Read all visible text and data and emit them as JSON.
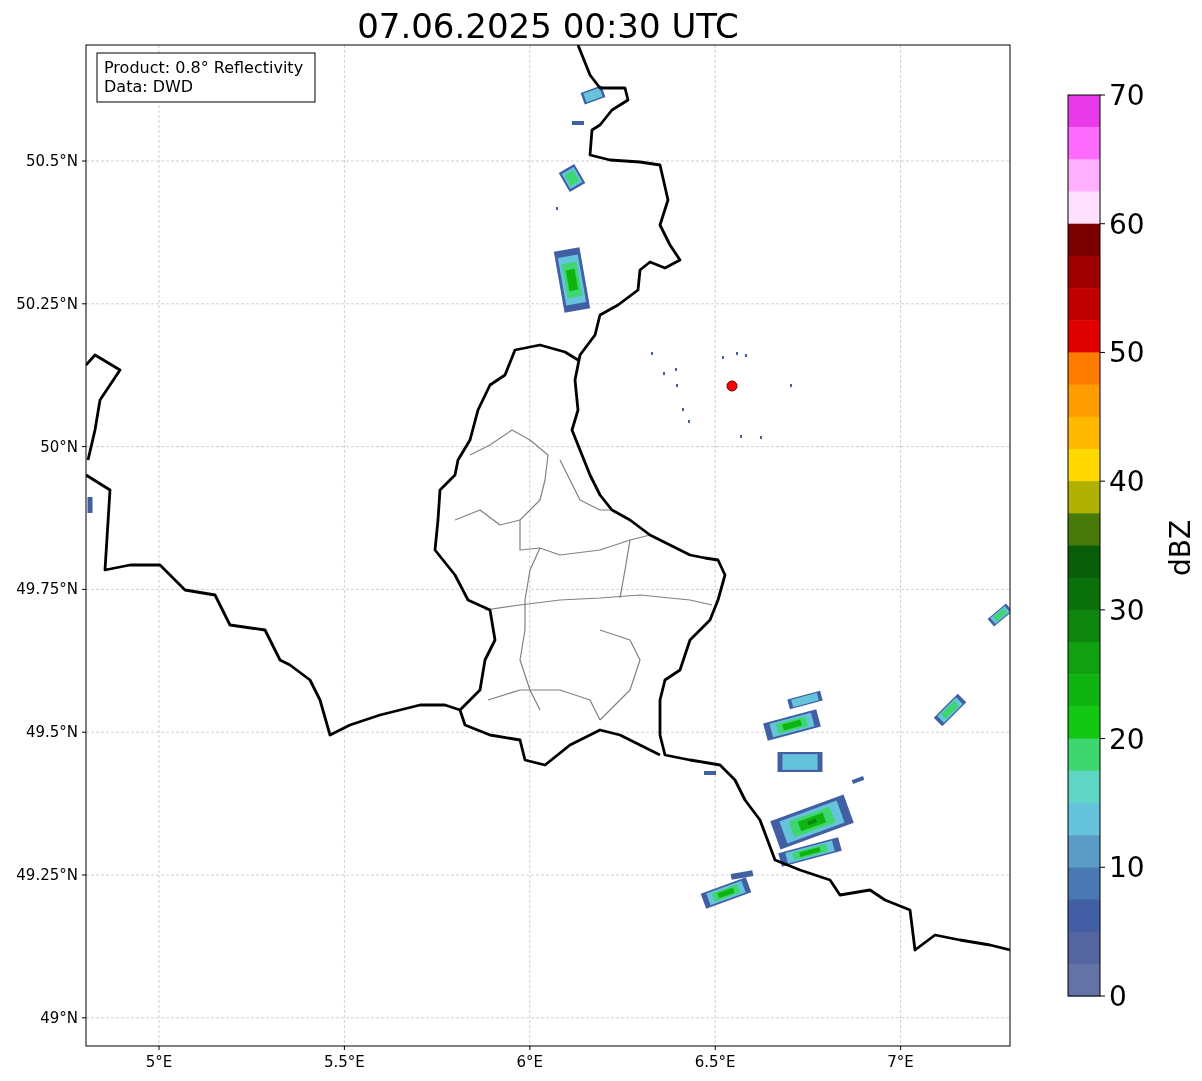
{
  "title": "07.06.2025 00:30 UTC",
  "info_box": [
    "Product: 0.8° Reflectivity",
    "Data: DWD"
  ],
  "map": {
    "xticks": [
      "5°E",
      "5.5°E",
      "6°E",
      "6.5°E",
      "7°E"
    ],
    "yticks": [
      "50.5°N",
      "50.25°N",
      "50°N",
      "49.75°N",
      "49.5°N",
      "49.25°N",
      "49°N"
    ]
  },
  "colorbar": {
    "label": "dBZ",
    "ticks": [
      "70",
      "60",
      "50",
      "40",
      "30",
      "20",
      "10",
      "0"
    ],
    "bins": [
      {
        "color": "#e83ae8"
      },
      {
        "color": "#ff6aff"
      },
      {
        "color": "#ffb0ff"
      },
      {
        "color": "#ffe0ff"
      },
      {
        "color": "#7a0000"
      },
      {
        "color": "#a00000"
      },
      {
        "color": "#c00000"
      },
      {
        "color": "#e00000"
      },
      {
        "color": "#ff7c00"
      },
      {
        "color": "#ff9c00"
      },
      {
        "color": "#ffb800"
      },
      {
        "color": "#ffd800"
      },
      {
        "color": "#b0b000"
      },
      {
        "color": "#487a0a"
      },
      {
        "color": "#085e08"
      },
      {
        "color": "#0a700a"
      },
      {
        "color": "#0e860e"
      },
      {
        "color": "#10a010"
      },
      {
        "color": "#10b410"
      },
      {
        "color": "#12c812"
      },
      {
        "color": "#3ed66f"
      },
      {
        "color": "#60d6c4"
      },
      {
        "color": "#66c3dc"
      },
      {
        "color": "#5a9cc6"
      },
      {
        "color": "#4a78b3"
      },
      {
        "color": "#435fa3"
      },
      {
        "color": "#5465a0"
      },
      {
        "color": "#6572a6"
      }
    ]
  }
}
